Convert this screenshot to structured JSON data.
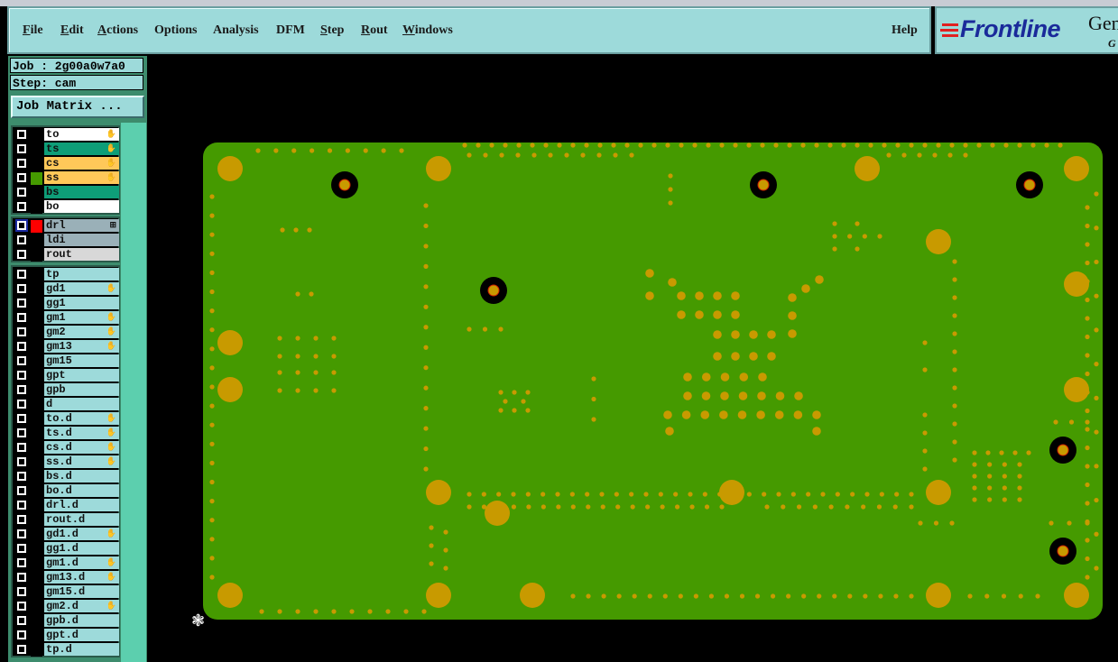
{
  "menu": [
    {
      "label": "File",
      "u": "F",
      "rest": "ile"
    },
    {
      "label": "Edit",
      "u": "E",
      "rest": "dit"
    },
    {
      "label": "Actions",
      "u": "A",
      "rest": "ctions"
    },
    {
      "label": "Options",
      "u": "",
      "rest": "Options"
    },
    {
      "label": "Analysis",
      "u": "",
      "rest": "Analysis"
    },
    {
      "label": "DFM",
      "u": "",
      "rest": "DFM"
    },
    {
      "label": "Step",
      "u": "S",
      "rest": "tep"
    },
    {
      "label": "Rout",
      "u": "R",
      "rest": "out"
    },
    {
      "label": "Windows",
      "u": "W",
      "rest": "indows"
    }
  ],
  "help_label": "Help",
  "logo": {
    "brand": "Frontline",
    "product": "Gen",
    "sub": "G"
  },
  "job": {
    "job_line": "Job : 2g00a0w7a0",
    "step_line": "Step: cam",
    "job_matrix_label": "Job Matrix ..."
  },
  "layer_groups": [
    [
      {
        "name": "to",
        "bg": "#ffffff",
        "hand": true
      },
      {
        "name": "ts",
        "bg": "#0e9e78",
        "hand": true
      },
      {
        "name": "cs",
        "bg": "#ffc859",
        "hand": true
      },
      {
        "name": "ss",
        "bg": "#ffc859",
        "hand": true,
        "swatch": "#459a00"
      },
      {
        "name": "bs",
        "bg": "#0e9e78"
      },
      {
        "name": "bo",
        "bg": "#ffffff"
      }
    ],
    [
      {
        "name": "drl",
        "bg": "#9ab0b8",
        "swatch": "#ff0000",
        "selected": true,
        "expand": true
      },
      {
        "name": "ldi",
        "bg": "#9ab0b8"
      },
      {
        "name": "rout",
        "bg": "#d8d8d8"
      }
    ],
    [
      {
        "name": "tp"
      },
      {
        "name": "gd1",
        "hand": true
      },
      {
        "name": "gg1"
      },
      {
        "name": "gm1",
        "hand": true
      },
      {
        "name": "gm2",
        "hand": true
      },
      {
        "name": "gm13",
        "hand": true
      },
      {
        "name": "gm15"
      },
      {
        "name": "gpt"
      },
      {
        "name": "gpb"
      },
      {
        "name": "d"
      },
      {
        "name": "to.d",
        "hand": true
      },
      {
        "name": "ts.d",
        "hand": true
      },
      {
        "name": "cs.d",
        "hand": true
      },
      {
        "name": "ss.d",
        "hand": true
      },
      {
        "name": "bs.d"
      },
      {
        "name": "bo.d"
      },
      {
        "name": "drl.d"
      },
      {
        "name": "rout.d"
      },
      {
        "name": "gd1.d",
        "hand": true
      },
      {
        "name": "gg1.d"
      },
      {
        "name": "gm1.d",
        "hand": true
      },
      {
        "name": "gm13.d",
        "hand": true
      },
      {
        "name": "gm15.d"
      },
      {
        "name": "gm2.d",
        "hand": true
      },
      {
        "name": "gpb.d"
      },
      {
        "name": "gpt.d"
      },
      {
        "name": "tp.d"
      }
    ]
  ],
  "icons": {
    "hand": "hand-pointer-icon",
    "expand": "expand-box-icon",
    "origin": "crosshair-origin-icon"
  },
  "colors": {
    "board": "#459a00",
    "pad": "#c89a00",
    "ui": "#9ddada",
    "canvas": "#000000"
  }
}
